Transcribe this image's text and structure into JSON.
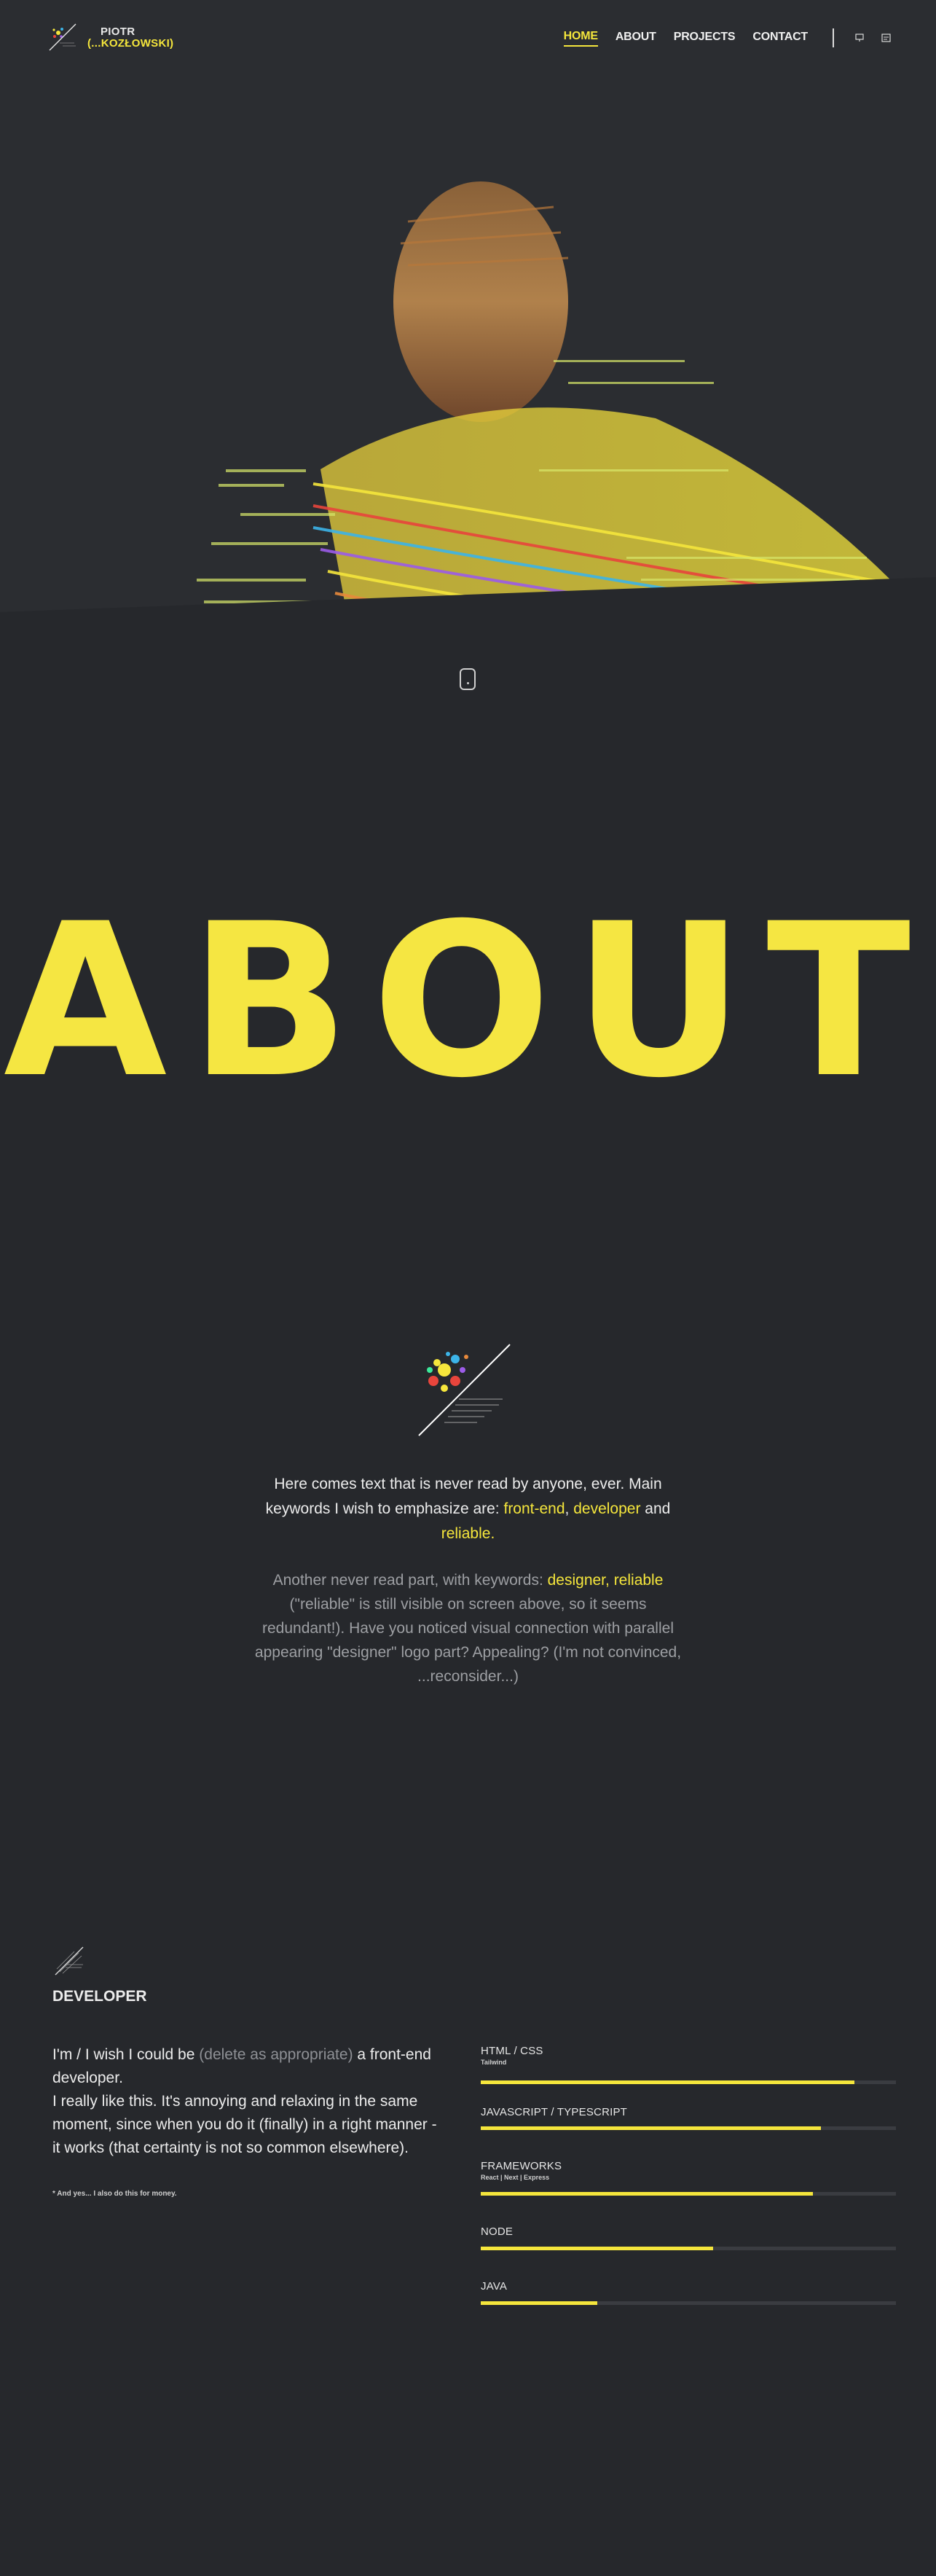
{
  "brand": {
    "line1": "PIOTR",
    "line2": "(...KOZŁOWSKI)"
  },
  "nav": {
    "links": [
      {
        "label": "HOME",
        "active": true
      },
      {
        "label": "ABOUT",
        "active": false
      },
      {
        "label": "PROJECTS",
        "active": false
      },
      {
        "label": "CONTACT",
        "active": false
      }
    ],
    "icons": [
      "monitor-icon",
      "card-icon"
    ]
  },
  "about": {
    "title": "ABOUT",
    "p1_a": "Here comes text that is never read by anyone, ever. Main keywords I wish to emphasize are: ",
    "p1_k1": "front-end",
    "p1_comma": ", ",
    "p1_k2": "developer",
    "p1_and": " and ",
    "p1_k3": "reliable",
    "p1_end": ".",
    "p2_a": "Another never read part, with keywords: ",
    "p2_k1": "designer",
    "p2_comma": ", ",
    "p2_k2": "reliable",
    "p2_b": " (\"reliable\" is still visible on screen above, so it seems redundant!). Have you noticed visual connection with parallel appearing \"designer\" logo part? Appealing? (I'm not convinced, ...reconsider...)"
  },
  "developer": {
    "title": "DEVELOPER",
    "text_a": "I'm / I wish I could be ",
    "text_muted": "(delete as appropriate)",
    "text_b": " a front-end developer.",
    "text_c": "I really like this. It's annoying and relaxing in the same moment, since when you do it (finally) in a right manner - it works (that certainty is not so common elsewhere).",
    "footnote": "* And yes... I also do this for money.",
    "skills": [
      {
        "name": "HTML / CSS",
        "sub": "Tailwind",
        "level": 0.9
      },
      {
        "name": "JAVASCRIPT / TYPESCRIPT",
        "sub": "",
        "level": 0.82
      },
      {
        "name": "FRAMEWORKS",
        "sub": "React | Next | Express",
        "level": 0.8
      },
      {
        "name": "NODE",
        "sub": "",
        "level": 0.56
      },
      {
        "name": "JAVA",
        "sub": "",
        "level": 0.28
      }
    ]
  },
  "colors": {
    "accent": "#f5e63c",
    "background": "#26282c",
    "nav_bg": "#2b2d31"
  }
}
